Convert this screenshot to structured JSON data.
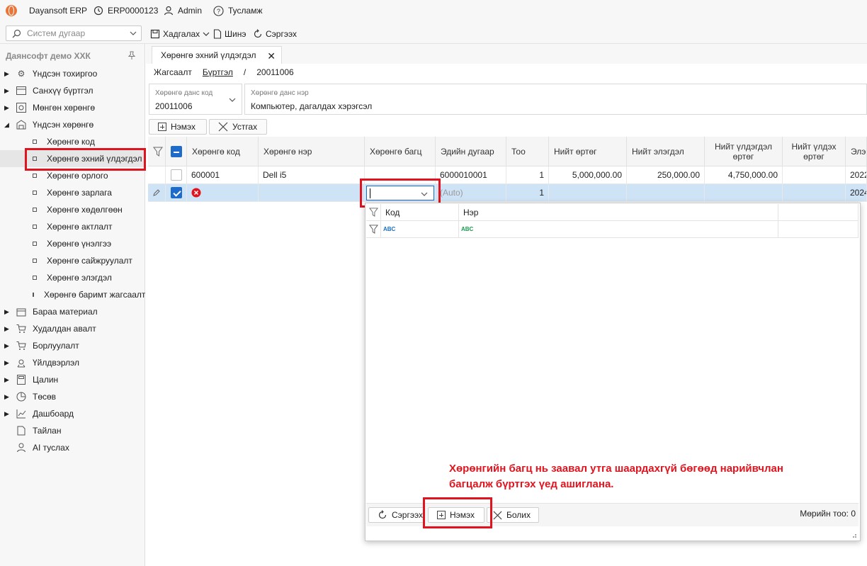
{
  "titlebar": {
    "app_name": "Dayansoft ERP",
    "db_code": "ERP0000123",
    "user": "Admin",
    "help": "Тусламж"
  },
  "toolbar": {
    "search_placeholder": "Систем дугаар",
    "save_label": "Хадгалах",
    "new_label": "Шинэ",
    "refresh_label": "Сэргээх"
  },
  "sidebar": {
    "company": "Даянсофт демо ХХК",
    "items": [
      {
        "label": "Үндсэн тохиргоо",
        "icon": "gear-icon"
      },
      {
        "label": "Санхүү бүртгэл",
        "icon": "ledger-icon"
      },
      {
        "label": "Мөнгөн хөрөнгө",
        "icon": "money-icon"
      },
      {
        "label": "Үндсэн хөрөнгө",
        "icon": "building-icon"
      }
    ],
    "subitems": [
      {
        "label": "Хөрөнгө код"
      },
      {
        "label": "Хөрөнгө эхний үлдэгдэл"
      },
      {
        "label": "Хөрөнгө орлого"
      },
      {
        "label": "Хөрөнгө зарлага"
      },
      {
        "label": "Хөрөнгө хөдөлгөөн"
      },
      {
        "label": "Хөрөнгө актлалт"
      },
      {
        "label": "Хөрөнгө үнэлгээ"
      },
      {
        "label": "Хөрөнгө сайжруулалт"
      },
      {
        "label": "Хөрөнгө элэгдэл"
      },
      {
        "label": "Хөрөнгө баримт жагсаалт"
      }
    ],
    "items2": [
      {
        "label": "Бараа материал",
        "icon": "box-icon"
      },
      {
        "label": "Худалдан авалт",
        "icon": "cart-icon"
      },
      {
        "label": "Борлуулалт",
        "icon": "cart-icon"
      },
      {
        "label": "Үйлдвэрлэл",
        "icon": "factory-icon"
      },
      {
        "label": "Цалин",
        "icon": "calculator-icon"
      },
      {
        "label": "Төсөв",
        "icon": "pie-icon"
      },
      {
        "label": "Дашбоард",
        "icon": "chart-icon"
      },
      {
        "label": "Тайлан",
        "icon": "report-icon"
      },
      {
        "label": "AI туслах",
        "icon": "person-icon"
      }
    ]
  },
  "tab": {
    "title": "Хөрөнгө эхний үлдэгдэл"
  },
  "breadcrumb": {
    "list": "Жагсаалт",
    "register": "Бүртгэл",
    "sep": "/",
    "code": "20011006"
  },
  "account": {
    "code_caption": "Хөрөнгө данс код",
    "code_value": "20011006",
    "name_caption": "Хөрөнгө данс нэр",
    "name_value": "Компьютер, дагалдах хэрэгсэл"
  },
  "actions": {
    "add": "Нэмэх",
    "delete": "Устгах"
  },
  "grid": {
    "columns": [
      "Хөрөнгө код",
      "Хөрөнгө нэр",
      "Хөрөнгө багц",
      "Эдийн дугаар",
      "Тоо",
      "Нийт өртөг",
      "Нийт элэгдэл",
      "Нийт үлдэгдэл өртөг",
      "Нийт үлдэх өртөг",
      "Элэг"
    ],
    "rows": [
      {
        "code": "600001",
        "name": "Dell i5",
        "pack": "",
        "item_no": "6000010001",
        "qty": "1",
        "cost": "5,000,000.00",
        "dep": "250,000.00",
        "net": "4,750,000.00",
        "residual": "",
        "date": "2022"
      },
      {
        "code": "",
        "name": "",
        "pack": "",
        "item_no": "(Auto)",
        "qty": "1",
        "cost": "",
        "dep": "",
        "net": "",
        "residual": "",
        "date": "2024"
      }
    ]
  },
  "popup": {
    "col_code": "Код",
    "col_name": "Нэр",
    "filter_abc": "ABC",
    "refresh": "Сэргээх",
    "add": "Нэмэх",
    "cancel": "Болих",
    "row_count": "Мөрийн тоо: 0"
  },
  "annotation": {
    "text": "Хөрөнгийн багц нь заавал утга шаардахгүй бөгөөд нарийвчлан багцалж бүртгэх үед ашиглана."
  },
  "colors": {
    "accent": "#1e6bc9",
    "highlight": "#e0141e",
    "row_selected": "#cfe3f7"
  }
}
